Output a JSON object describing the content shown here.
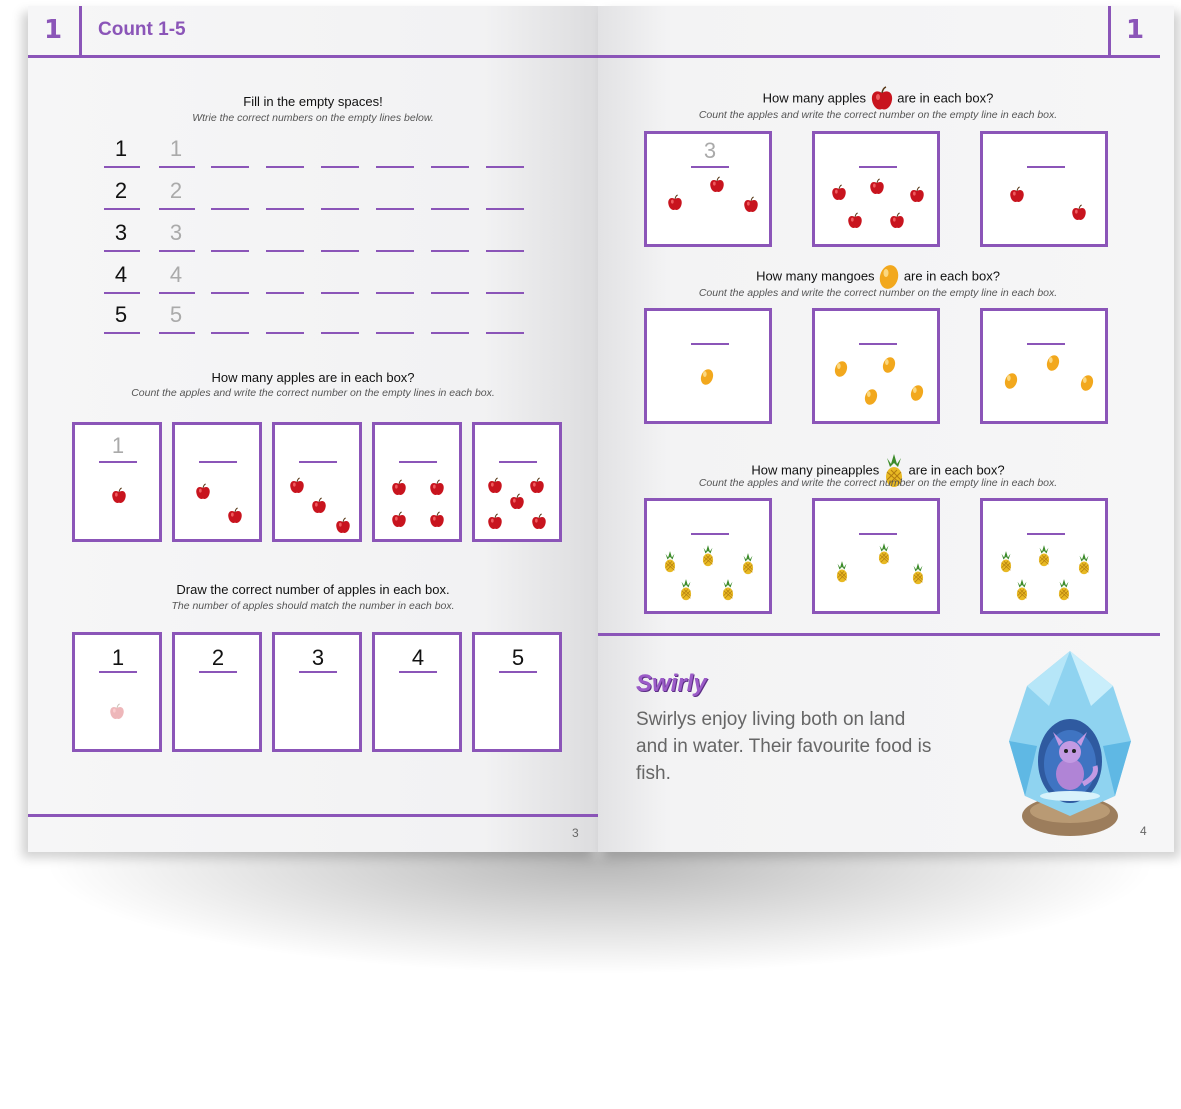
{
  "left_page": {
    "chapter_number": "1",
    "chapter_title": "Count 1-5",
    "page_number": "3",
    "section1": {
      "heading": "Fill in the empty spaces!",
      "subheading": "Wtrie the correct numbers on the empty lines below.",
      "rows": [
        {
          "number": "1",
          "trace": "1"
        },
        {
          "number": "2",
          "trace": "2"
        },
        {
          "number": "3",
          "trace": "3"
        },
        {
          "number": "4",
          "trace": "4"
        },
        {
          "number": "5",
          "trace": "5"
        }
      ]
    },
    "section2": {
      "heading": "How many apples are in each box?",
      "subheading": "Count the apples and write the correct number on the empty lines in each box.",
      "example_answer": "1",
      "apple_counts": [
        1,
        2,
        3,
        4,
        5
      ]
    },
    "section3": {
      "heading": "Draw the correct number of apples in each box.",
      "subheading": "The number of apples should match the number in each box.",
      "box_numbers": [
        "1",
        "2",
        "3",
        "4",
        "5"
      ]
    }
  },
  "right_page": {
    "chapter_number": "1",
    "page_number": "4",
    "apples": {
      "heading_before": "How many apples",
      "heading_after": "are in each box?",
      "subheading": "Count the apples and write the correct number on the empty line in each box.",
      "example_answer": "3",
      "counts": [
        3,
        5,
        2
      ]
    },
    "mangoes": {
      "heading_before": "How many mangoes",
      "heading_after": "are in each box?",
      "subheading": "Count the apples and write the correct number on the empty line in each box.",
      "counts": [
        1,
        4,
        3
      ]
    },
    "pineapples": {
      "heading_before": "How many pineapples",
      "heading_after": "are in each box?",
      "subheading": "Count the apples and write the correct number on the empty line in each box.",
      "counts": [
        5,
        3,
        5
      ]
    },
    "creature": {
      "name": "Swirly",
      "description": "Swirlys enjoy living both on land and in water. Their favourite food is fish."
    }
  },
  "colors": {
    "accent": "#8b55b8",
    "apple": "#c8141e",
    "mango": "#f2a81d",
    "pineapple": "#e8b923",
    "crystal": "#8fd3f0"
  }
}
